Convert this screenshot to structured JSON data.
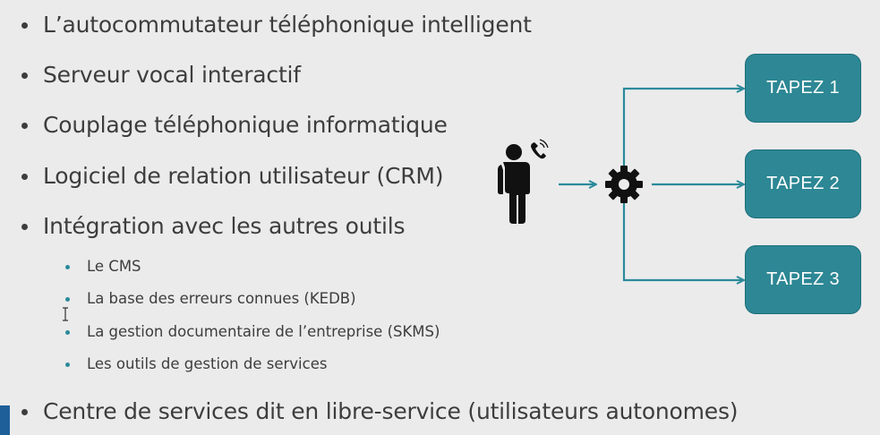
{
  "bullets": {
    "main": [
      "L’autocommutateur téléphonique intelligent",
      "Serveur vocal interactif",
      "Couplage téléphonique informatique",
      "Logiciel de relation utilisateur (CRM)",
      "Intégration avec les autres outils"
    ],
    "sub": [
      "Le CMS",
      "La base des erreurs connues (KEDB)",
      "La gestion documentaire de l’entreprise (SKMS)",
      "Les outils de gestion de services"
    ],
    "last": "Centre de services dit en libre-service (utilisateurs autonomes)"
  },
  "diagram": {
    "boxes": [
      "TAPEZ 1",
      "TAPEZ 2",
      "TAPEZ 3"
    ],
    "caller_icon": "person-with-phone-icon",
    "router_icon": "gear-icon"
  },
  "colors": {
    "background": "#ebebec",
    "accent": "#2a8b9a",
    "box_fill": "#2d8794",
    "text": "#3d3d3d",
    "left_accent": "#1f5f99"
  }
}
